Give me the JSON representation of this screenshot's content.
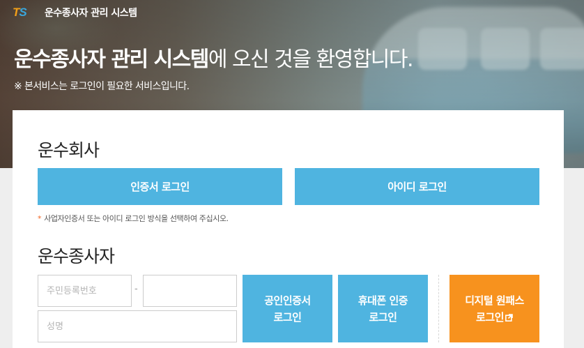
{
  "header": {
    "logo_t": "T",
    "logo_s": "S",
    "app_title": "운수종사자 관리 시스템"
  },
  "hero": {
    "welcome_bold": "운수종사자 관리 시스템",
    "welcome_rest": "에 오신 것을 환영합니다.",
    "notice": "※ 본서비스는 로그인이 필요한 서비스입니다."
  },
  "company": {
    "title": "운수회사",
    "cert_login_label": "인증서 로그인",
    "id_login_label": "아이디 로그인",
    "hint_star": "*",
    "hint_text": "사업자인증서 또는 아이디 로그인 방식을 선택하여 주십시오."
  },
  "driver": {
    "title": "운수종사자",
    "rrn_placeholder": "주민등록번호",
    "rrn_dash": "-",
    "rrn_back_value": "",
    "name_placeholder": "성명",
    "pki_login_line1": "공인인증서",
    "pki_login_line2": "로그인",
    "phone_login_line1": "휴대폰 인증",
    "phone_login_line2": "로그인",
    "onepass_line1": "디지털 원패스",
    "onepass_line2": "로그인"
  },
  "colors": {
    "button_blue": "#4fb4e0",
    "button_orange": "#f7921e",
    "logo_orange": "#f3a019",
    "logo_blue": "#3aa7dd"
  },
  "icons": {
    "onepass_icon": "external-link-icon"
  }
}
